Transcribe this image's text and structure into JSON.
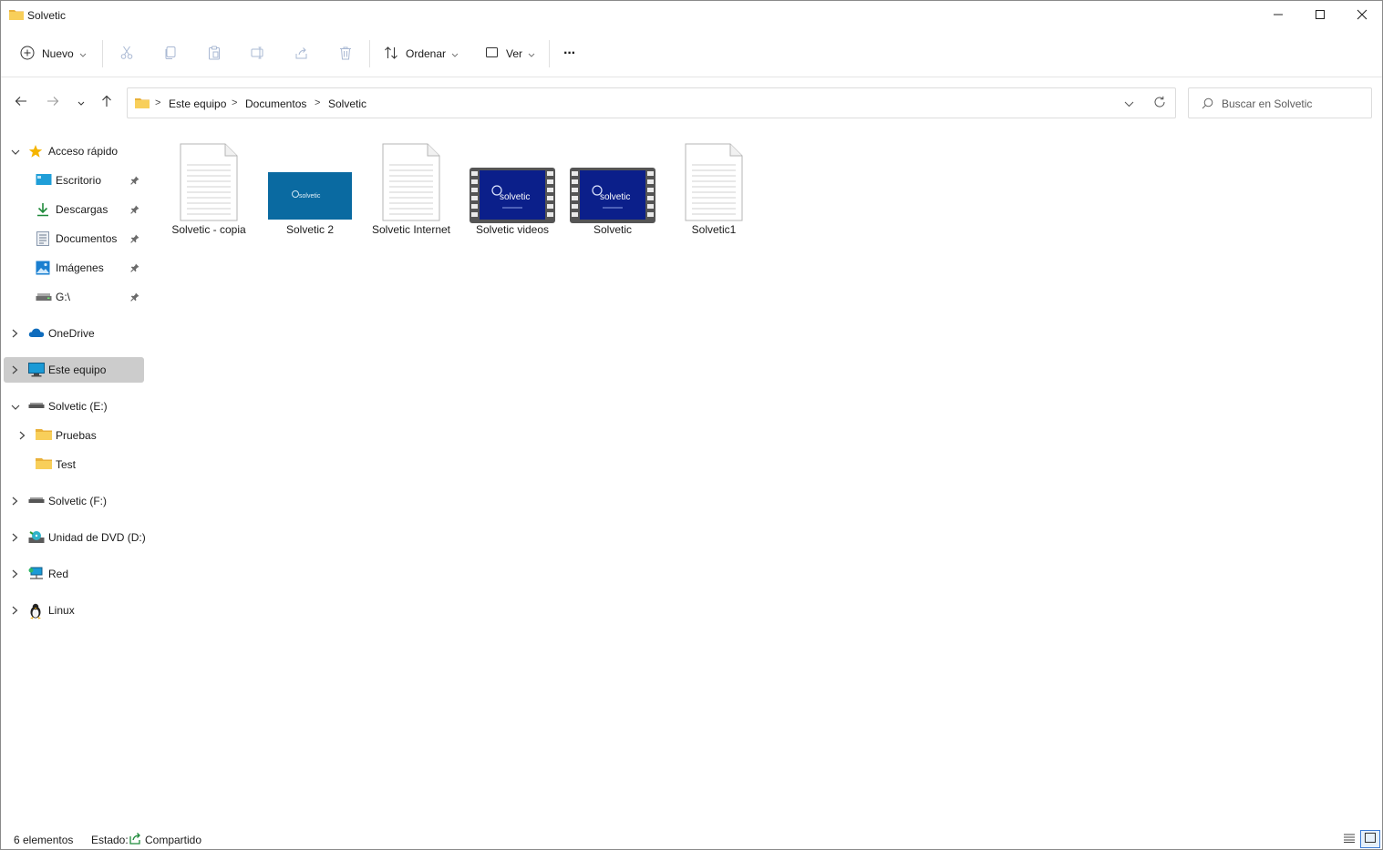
{
  "window": {
    "title": "Solvetic"
  },
  "toolbar": {
    "new_label": "Nuevo",
    "sort_label": "Ordenar",
    "view_label": "Ver",
    "more_label": "···"
  },
  "address": {
    "crumbs": [
      "Este equipo",
      "Documentos",
      "Solvetic"
    ],
    "separator": ">"
  },
  "search": {
    "placeholder": "Buscar en Solvetic"
  },
  "nav": {
    "items": [
      {
        "label": "Acceso rápido",
        "icon": "star-icon",
        "expanded": true
      },
      {
        "label": "Escritorio",
        "icon": "desktop-icon",
        "pinned": true
      },
      {
        "label": "Descargas",
        "icon": "download-icon",
        "pinned": true
      },
      {
        "label": "Documentos",
        "icon": "document-icon",
        "pinned": true
      },
      {
        "label": "Imágenes",
        "icon": "pictures-icon",
        "pinned": true
      },
      {
        "label": "G:\\",
        "icon": "drive-icon",
        "pinned": true
      },
      {
        "label": "OneDrive",
        "icon": "cloud-icon",
        "expanded": false
      },
      {
        "label": "Este equipo",
        "icon": "computer-icon",
        "expanded": false,
        "selected": true
      },
      {
        "label": "Solvetic (E:)",
        "icon": "drive-icon",
        "expanded": true
      },
      {
        "label": "Pruebas",
        "icon": "folder-icon",
        "expanded": false
      },
      {
        "label": "Test",
        "icon": "folder-icon"
      },
      {
        "label": "Solvetic (F:)",
        "icon": "drive-icon",
        "expanded": false
      },
      {
        "label": "Unidad de DVD (D:)",
        "icon": "dvd-icon",
        "expanded": false
      },
      {
        "label": "Red",
        "icon": "network-icon",
        "expanded": false
      },
      {
        "label": "Linux",
        "icon": "linux-icon",
        "expanded": false
      }
    ]
  },
  "files": [
    {
      "name": "Solvetic - copia",
      "type": "document"
    },
    {
      "name": "Solvetic 2",
      "type": "image"
    },
    {
      "name": "Solvetic Internet",
      "type": "document"
    },
    {
      "name": "Solvetic videos",
      "type": "video"
    },
    {
      "name": "Solvetic",
      "type": "video"
    },
    {
      "name": "Solvetic1",
      "type": "document"
    }
  ],
  "thumb_text": {
    "logo": "Solvetic",
    "logo_small": "solvetic"
  },
  "status": {
    "count": "6 elementos",
    "state_label": "Estado:",
    "state_value": "Compartido"
  },
  "colors": {
    "folder": "#f4c14a",
    "accent": "#0067c0",
    "video_bg": "#0b1f8a",
    "image_bg": "#0a6aa1"
  }
}
